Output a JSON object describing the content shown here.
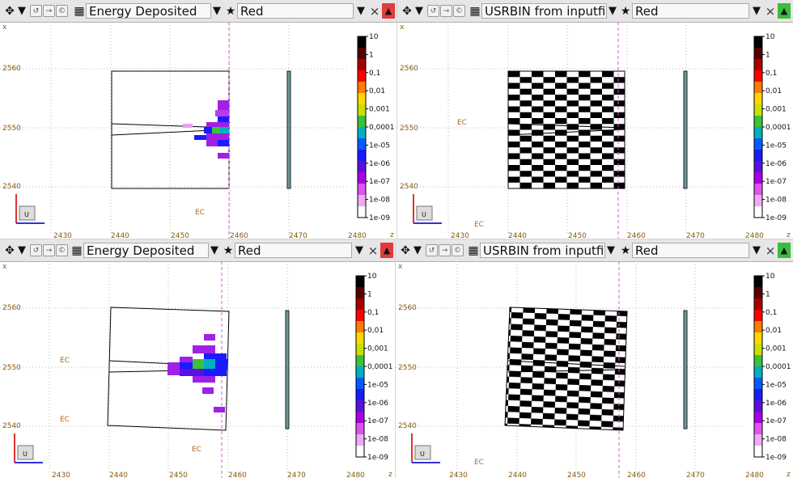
{
  "panels": [
    {
      "id": "tl",
      "field": "Energy Deposited",
      "color_label": "Red",
      "star": "★",
      "close": "×",
      "err_color": "#e23b3b"
    },
    {
      "id": "tr",
      "field": "USRBIN from inputfil",
      "color_label": "Red",
      "star": "★",
      "close": "×",
      "err_color": "#3bbd3b"
    },
    {
      "id": "bl",
      "field": "Energy Deposited",
      "color_label": "Red",
      "star": "★",
      "close": "×",
      "err_color": "#e23b3b"
    },
    {
      "id": "br",
      "field": "USRBIN from inputfil",
      "color_label": "Red",
      "star": "★",
      "close": "×",
      "err_color": "#3bbd3b"
    }
  ],
  "axes": {
    "x_ticks": [
      "2430",
      "2440",
      "2450",
      "2460",
      "2470",
      "2480"
    ],
    "y_ticks": [
      "2560",
      "2550",
      "2540"
    ],
    "x_axis_letter": "z",
    "y_axis_letter": "x",
    "ec_label": "EC",
    "gizmo_label": "U"
  },
  "colorbar": {
    "labels": [
      "10",
      "1",
      "0,1",
      "0,01",
      "0,001",
      "0,0001",
      "1e-05",
      "1e-06",
      "1e-07",
      "1e-08",
      "1e-09"
    ],
    "colors": [
      "#000000",
      "#550000",
      "#a80000",
      "#ff0000",
      "#ff7d00",
      "#ffd800",
      "#c8e000",
      "#3ac23a",
      "#00b0c0",
      "#005cff",
      "#1a1aff",
      "#5c10e0",
      "#a800e6",
      "#dd55ee",
      "#eeaaf4",
      "#ffffff"
    ]
  },
  "icons": {
    "move": "move-icon",
    "dropdown": "chevron-down-icon",
    "refresh": "refresh-icon",
    "forward": "forward-icon",
    "copy": "copy-icon",
    "layers": "layers-icon",
    "star": "star-icon",
    "close": "close-icon",
    "error": "warning-icon"
  }
}
